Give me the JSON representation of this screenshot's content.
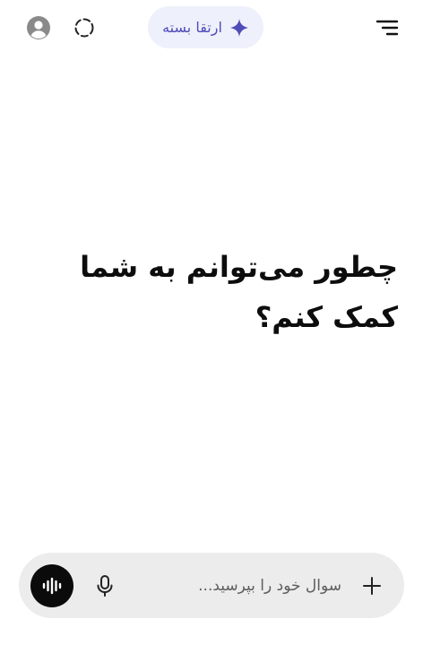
{
  "header": {
    "upgrade_label": "ارتقا بسته",
    "icons": {
      "account": "account-circle-icon",
      "capture": "dashed-circle-icon",
      "menu": "menu-icon",
      "upgrade": "sparkle-icon"
    }
  },
  "main": {
    "greeting": "چطور می‌توانم به شما کمک کنم؟"
  },
  "composer": {
    "placeholder": "سوال خود را بپرسید...",
    "value": "",
    "icons": {
      "add": "plus-icon",
      "dictate": "microphone-icon",
      "voice_mode": "voice-waveform-icon"
    }
  },
  "colors": {
    "accent": "#4f4cb7",
    "pill_background": "#eef0fb",
    "composer_background": "#ececec",
    "voice_button": "#0b0b0b"
  }
}
